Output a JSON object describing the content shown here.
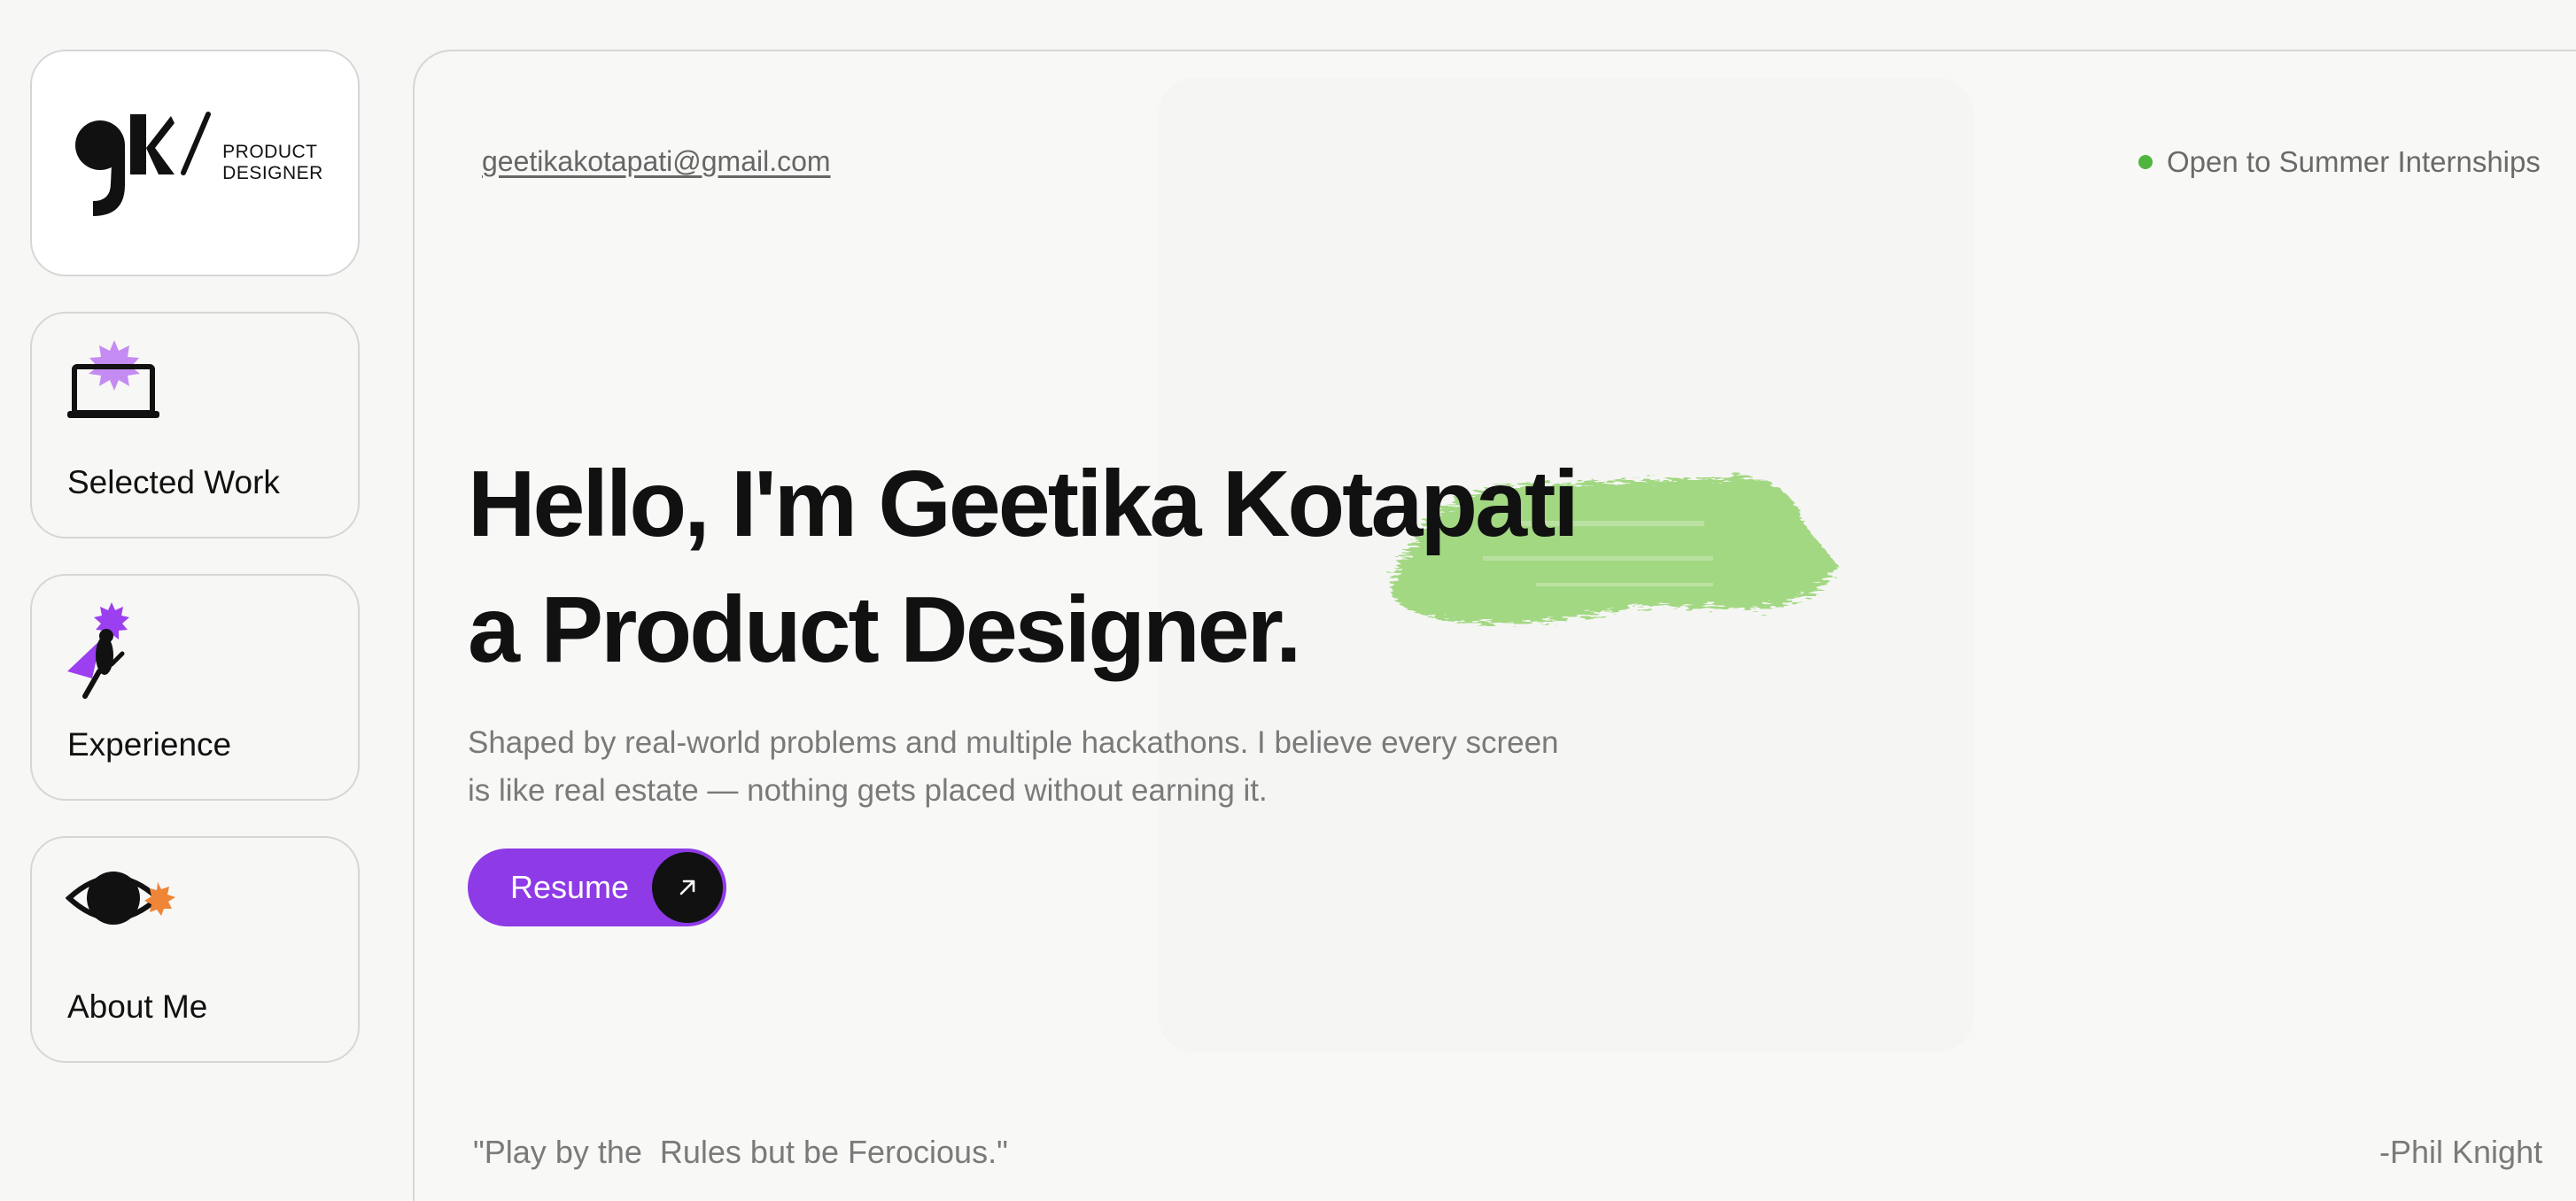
{
  "logo": {
    "mark": "gk",
    "line1": "PRODUCT",
    "line2": "DESIGNER"
  },
  "sidebar": {
    "items": [
      {
        "label": "Selected Work",
        "icon": "laptop-icon"
      },
      {
        "label": "Experience",
        "icon": "flying-figure-icon"
      },
      {
        "label": "About Me",
        "icon": "eye-icon"
      }
    ]
  },
  "header": {
    "email": "geetikakotapati@gmail.com",
    "status": "Open to Summer Internships"
  },
  "hero": {
    "line1": "Hello, I'm Geetika Kotapati",
    "line2": "a Product Designer.",
    "description": "Shaped by real-world problems and multiple hackathons. I believe every screen is like real estate — nothing gets placed without earning it.",
    "resume_label": "Resume"
  },
  "footer": {
    "quote": "\"Play by the  Rules but be Ferocious.\"",
    "author": "-Phil Knight"
  },
  "colors": {
    "accent": "#8e3ae6",
    "status_dot": "#4fb53e",
    "brush": "#9fd77e",
    "eye_badge": "#ef8536"
  }
}
